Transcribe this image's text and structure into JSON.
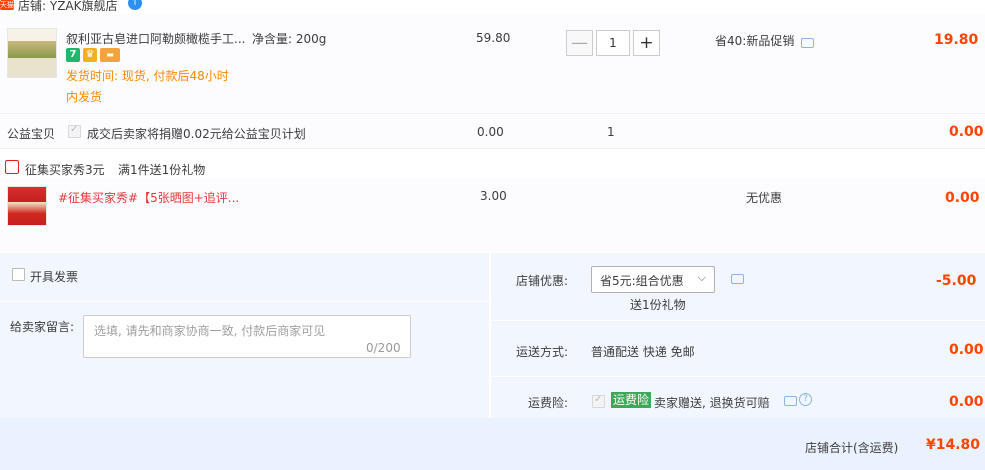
{
  "shop": {
    "badge": "天猫",
    "name": "店铺: YZAK旗舰店",
    "ww": "i"
  },
  "item": {
    "title": "叙利亚古皂进口阿勒颇橄榄手工...",
    "spec": "净含量: 200g",
    "delivery_line1": "发货时间: 现货, 付款后48小时",
    "delivery_line2": "内发货",
    "badge_icons": [
      "7",
      "♛",
      "▬"
    ],
    "unit_price": "59.80",
    "quantity": "1",
    "qty_minus": "—",
    "qty_plus": "+",
    "promo": "省40:新品促销",
    "subtotal": "19.80"
  },
  "charity": {
    "label": "公益宝贝",
    "text": "成交后卖家将捐赠0.02元给公益宝贝计划",
    "price": "0.00",
    "quantity": "1",
    "subtotal": "0.00"
  },
  "gift_promo": {
    "title": "征集买家秀3元",
    "detail": "满1件送1份礼物"
  },
  "gift_item": {
    "title": "#征集买家秀#【5张晒图+追评...",
    "price": "3.00",
    "promo": "无优惠",
    "subtotal": "0.00"
  },
  "invoice": {
    "label": "开具发票"
  },
  "note": {
    "label": "给卖家留言:",
    "placeholder": "选填, 请先和商家协商一致, 付款后商家可见",
    "counter": "0/200"
  },
  "shop_discount": {
    "label": "店铺优惠:",
    "selected": "省5元:组合优惠",
    "sub": "送1份礼物",
    "value": "-5.00"
  },
  "shipping": {
    "label": "运送方式:",
    "method": "普通配送 快递 免邮",
    "value": "0.00"
  },
  "insurance": {
    "label": "运费险:",
    "badge": "运费险",
    "text": "卖家赠送, 退换货可赔",
    "value": "0.00"
  },
  "total": {
    "label": "店铺合计(含运费)",
    "value": "¥14.80"
  },
  "colors": {
    "accent_red": "#ff4400",
    "link_blue": "#2c90f0",
    "panel_bg": "#f2f7ff",
    "badge_green": "#3ea85a"
  }
}
